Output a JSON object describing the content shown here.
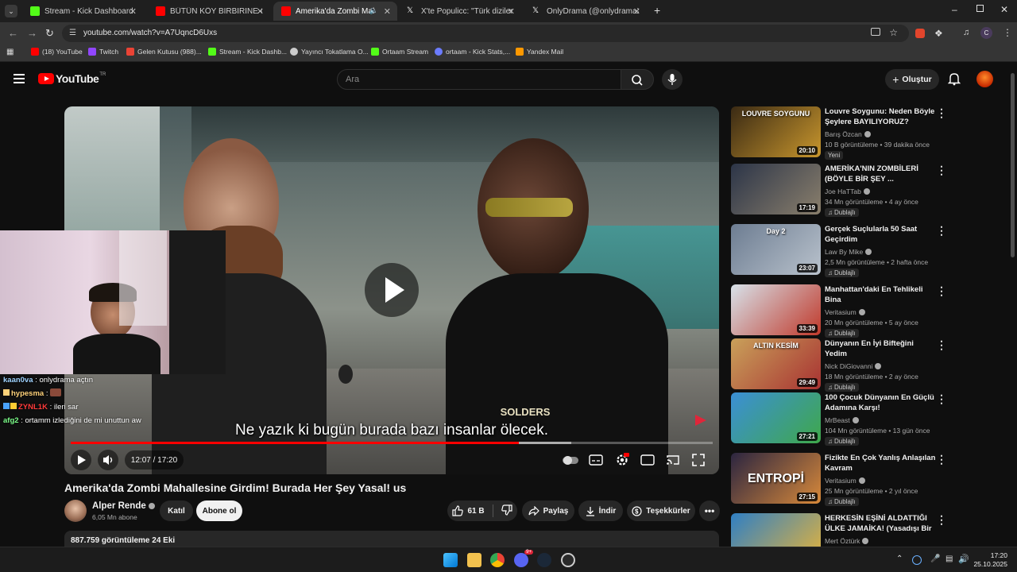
{
  "browser": {
    "tabs": [
      {
        "label": "Stream - Kick Dashboard",
        "color": "#53fc18"
      },
      {
        "label": "BÜTÜN KÖY BİRBİRİNE GİRMİŞ",
        "color": "#ff0000"
      },
      {
        "label": "Amerika'da Zombi Mahalle",
        "color": "#ff0000"
      },
      {
        "label": "X'te Populicc: \"Türk dizilerinde",
        "color": "#ffffff"
      },
      {
        "label": "OnlyDrama (@onlydramaX) / X",
        "color": "#ffffff"
      }
    ],
    "url": "youtube.com/watch?v=A7UqncD6Uxs",
    "bookmarks": [
      {
        "label": "(18) YouTube",
        "color": "#ff0000"
      },
      {
        "label": "Twitch",
        "color": "#9146ff"
      },
      {
        "label": "Gelen Kutusu (988)...",
        "color": "#ea4335"
      },
      {
        "label": "Stream - Kick Dashb...",
        "color": "#53fc18"
      },
      {
        "label": "Yayıncı Tokatlama O...",
        "color": "#cccccc"
      },
      {
        "label": "Ortaam Stream",
        "color": "#53fc18"
      },
      {
        "label": "ortaam - Kick Stats,...",
        "color": "#6c7cff"
      },
      {
        "label": "Yandex Mail",
        "color": "#ff9900"
      }
    ]
  },
  "youtube": {
    "logo_text": "YouTube",
    "logo_sup": "TR",
    "search_placeholder": "Ara",
    "create_label": "Oluştur"
  },
  "video": {
    "caption": "Ne yazık ki bugün burada bazı insanlar ölecek.",
    "time": "12:07 / 17:20",
    "progress_fraction": 0.698,
    "buffer_fraction": 0.78,
    "title": "Amerika'da Zombi Mahallesine Girdim! Burada Her Şey Yasal! us",
    "channel": "Alper Rende",
    "subscribers": "6,05 Mn abone",
    "join_label": "Katıl",
    "subscribe_label": "Abone ol",
    "likes": "61 B",
    "share_label": "Paylaş",
    "download_label": "İndir",
    "thanks_label": "Teşekkürler",
    "views_line": "887.759 görüntüleme  24 Eki",
    "shirt_text": "SOLDERS"
  },
  "chat": [
    {
      "user": "kaan0va",
      "msg": "onlydrama açtın",
      "color": "#9fd3ff"
    },
    {
      "user": "hypesma",
      "msg": "",
      "color": "#ffd27a"
    },
    {
      "user": "ZYNL1K",
      "msg": "ileri sar",
      "color": "#ff3b3b"
    },
    {
      "user": "afg2",
      "msg": "ortamm izlediğini de mi unuttun aw",
      "color": "#7dff8a"
    }
  ],
  "recommendations": [
    {
      "title": "Louvre Soygunu: Neden Böyle Şeylere BAYILIYORUZ?",
      "channel": "Barış Özcan",
      "meta": "10 B görüntüleme • 39 dakika önce",
      "badge": "Yeni",
      "duration": "20:10",
      "thumb_text": "LOUVRE SOYGUNU",
      "colors": [
        "#3a2a14",
        "#c8962d"
      ]
    },
    {
      "title": "AMERİKA'NIN ZOMBİLERİ (BÖYLE BİR ŞEY ...",
      "channel": "Joe HaTTab",
      "meta": "34 Mn görüntüleme • 4 ay önce",
      "badge": "Dublajlı",
      "duration": "17:19",
      "thumb_text": "",
      "colors": [
        "#2c3548",
        "#8a7f6c"
      ]
    },
    {
      "title": "Gerçek Suçlularla 50 Saat Geçirdim",
      "channel": "Law By Mike",
      "meta": "2,5 Mn görüntüleme • 2 hafta önce",
      "badge": "Dublajlı",
      "duration": "23:07",
      "thumb_text": "Day 2",
      "colors": [
        "#6d7d92",
        "#b9c2cc"
      ]
    },
    {
      "title": "Manhattan'daki En Tehlikeli Bina",
      "channel": "Veritasium",
      "meta": "20 Mn görüntüleme • 5 ay önce",
      "badge": "Dublajlı",
      "duration": "33:39",
      "thumb_text": "",
      "colors": [
        "#d7e2ea",
        "#c0392b"
      ]
    },
    {
      "title": "Dünyanın En İyi Bifteğini Yedim",
      "channel": "Nick DiGiovanni",
      "meta": "18 Mn görüntüleme • 2 ay önce",
      "badge": "Dublajlı",
      "duration": "29:49",
      "thumb_text": "ALTIN KESİM",
      "colors": [
        "#c9a15a",
        "#a83232"
      ]
    },
    {
      "title": "100 Çocuk Dünyanın En Güçlü Adamına Karşı!",
      "channel": "MrBeast",
      "meta": "104 Mn görüntüleme • 13 gün önce",
      "badge": "Dublajlı",
      "duration": "27:21",
      "thumb_text": "",
      "colors": [
        "#3b8fd6",
        "#3fa84a"
      ]
    },
    {
      "title": "Fizikte En Çok Yanlış Anlaşılan Kavram",
      "channel": "Veritasium",
      "meta": "25 Mn görüntüleme • 2 yıl önce",
      "badge": "Dublajlı",
      "duration": "27:15",
      "thumb_text": "ENTROPİ",
      "colors": [
        "#2b2540",
        "#d8893a"
      ]
    },
    {
      "title": "HERKESİN EŞİNİ ALDATTIĞI ÜLKE JAMAİKA! (Yasadışı Bir ...",
      "channel": "Mert Öztürk",
      "meta": "",
      "badge": "",
      "duration": "",
      "thumb_text": "",
      "colors": [
        "#2f7fc4",
        "#e6b43a"
      ]
    }
  ],
  "taskbar": {
    "time": "17:20",
    "date": "25.10.2025",
    "discord_badge": "9+"
  },
  "colors": {
    "accent": "#ff0000",
    "background": "#0f0f0f",
    "kick": "#53fc18"
  }
}
